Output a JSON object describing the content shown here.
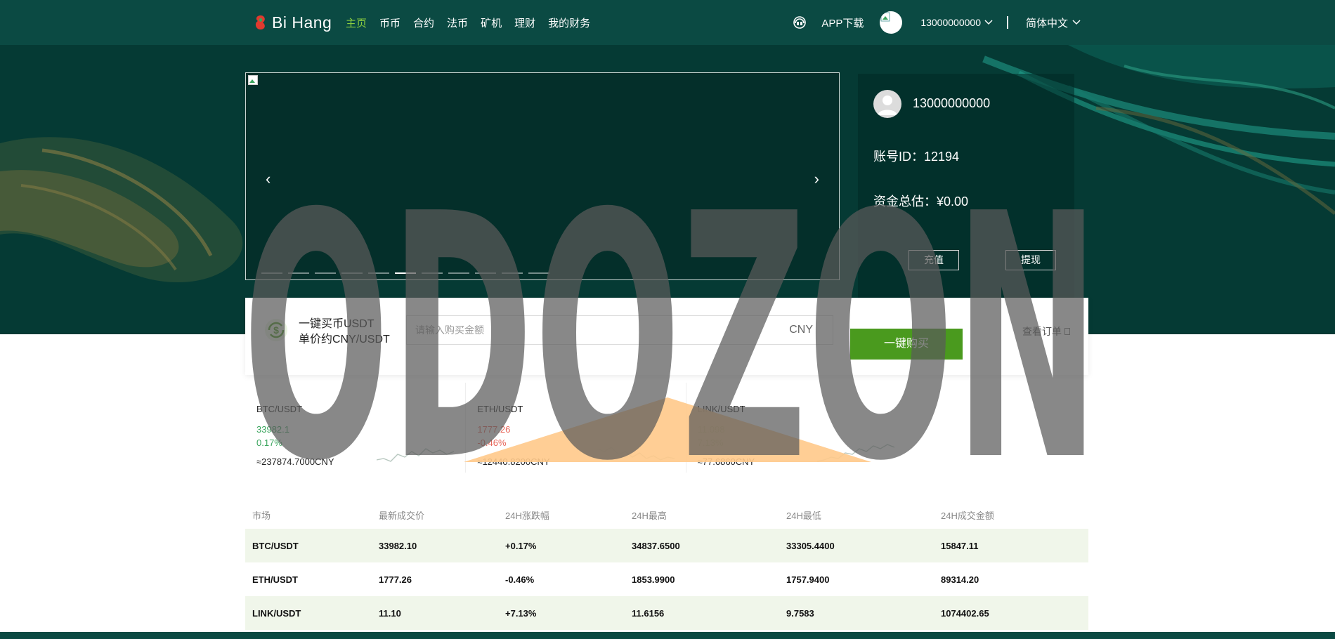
{
  "nav": {
    "logo_text": "Bi Hang",
    "links": [
      "主页",
      "币币",
      "合约",
      "法币",
      "矿机",
      "理财",
      "我的财务"
    ],
    "active_index": 0,
    "app_download": "APP下载",
    "username": "13000000000",
    "language": "简体中文"
  },
  "banner": {
    "prev": "‹",
    "next": "›",
    "slide_count": 11,
    "active_slide": 5
  },
  "user_card": {
    "name": "13000000000",
    "account_id": "账号ID：12194",
    "total_assets": "资金总估：¥0.00",
    "deposit_label": "充值",
    "withdraw_label": "提现"
  },
  "quick_buy": {
    "title_line1": "一键买币USDT",
    "title_line2": "单价约CNY/USDT",
    "input_placeholder": "请输入购买金额",
    "unit": "CNY",
    "buy_label": "一键购买",
    "orders_label": "查看订单"
  },
  "tickers": [
    {
      "pair": "BTC/USDT",
      "price": "33982.1",
      "change": "0.17%",
      "cny": "≈237874.7000CNY",
      "trend": "up",
      "color": "#3aa55d"
    },
    {
      "pair": "ETH/USDT",
      "price": "1777.26",
      "change": "-0.46%",
      "cny": "≈12440.8200CNY",
      "trend": "down",
      "color": "#e8665a"
    },
    {
      "pair": "LINK/USDT",
      "price": "11.098",
      "change": "7.13%",
      "cny": "≈77.6860CNY",
      "trend": "up",
      "color": "#6fb23b"
    }
  ],
  "market": {
    "headers": [
      "市场",
      "最新成交价",
      "24H涨跌幅",
      "24H最高",
      "24H最低",
      "24H成交金额"
    ],
    "rows": [
      [
        "BTC/USDT",
        "33982.10",
        "+0.17%",
        "34837.6500",
        "33305.4400",
        "15847.11"
      ],
      [
        "ETH/USDT",
        "1777.26",
        "-0.46%",
        "1853.9900",
        "1757.9400",
        "89314.20"
      ],
      [
        "LINK/USDT",
        "11.10",
        "+7.13%",
        "11.6156",
        "9.7583",
        "1074402.65"
      ]
    ]
  },
  "watermark": {
    "text": "ODOZON"
  },
  "colors": {
    "nav_bg": "#0b4a43",
    "accent_green": "#4a9a1e",
    "active_link": "#8ccf3f",
    "up": "#3aa55d",
    "down": "#e8665a"
  }
}
